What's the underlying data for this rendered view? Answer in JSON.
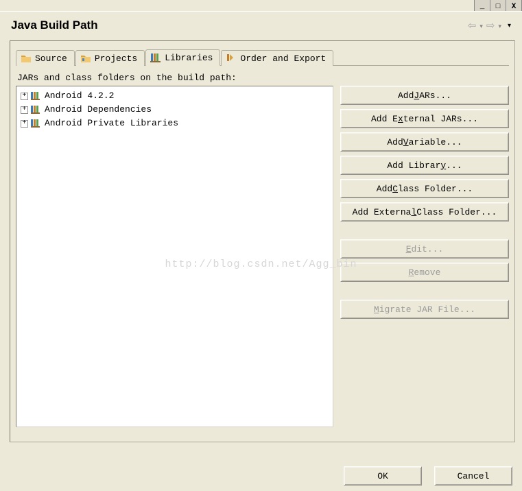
{
  "window": {
    "title": "Java Build Path"
  },
  "tabs": [
    {
      "label": "Source",
      "icon": "source"
    },
    {
      "label": "Projects",
      "icon": "projects"
    },
    {
      "label": "Libraries",
      "icon": "libraries",
      "active": true
    },
    {
      "label": "Order and Export",
      "icon": "order"
    }
  ],
  "section_label": "JARs and class folders on the build path:",
  "tree_items": [
    {
      "label": "Android 4.2.2"
    },
    {
      "label": "Android Dependencies"
    },
    {
      "label": "Android Private Libraries"
    }
  ],
  "buttons": {
    "add_jars": {
      "pre": "Add ",
      "u": "J",
      "post": "ARs...",
      "enabled": true
    },
    "add_external_jars": {
      "pre": "Add E",
      "u": "x",
      "post": "ternal JARs...",
      "enabled": true
    },
    "add_variable": {
      "pre": "Add ",
      "u": "V",
      "post": "ariable...",
      "enabled": true
    },
    "add_library": {
      "pre": "Add Librar",
      "u": "y",
      "post": "...",
      "enabled": true
    },
    "add_class_folder": {
      "pre": "Add ",
      "u": "C",
      "post": "lass Folder...",
      "enabled": true
    },
    "add_ext_class_folder": {
      "pre": "Add Externa",
      "u": "l",
      "post": " Class Folder...",
      "enabled": true
    },
    "edit": {
      "pre": "",
      "u": "E",
      "post": "dit...",
      "enabled": false
    },
    "remove": {
      "pre": "",
      "u": "R",
      "post": "emove",
      "enabled": false
    },
    "migrate": {
      "pre": "",
      "u": "M",
      "post": "igrate JAR File...",
      "enabled": false
    }
  },
  "footer": {
    "ok": "OK",
    "cancel": "Cancel"
  },
  "watermark": "http://blog.csdn.net/Agg_bin"
}
